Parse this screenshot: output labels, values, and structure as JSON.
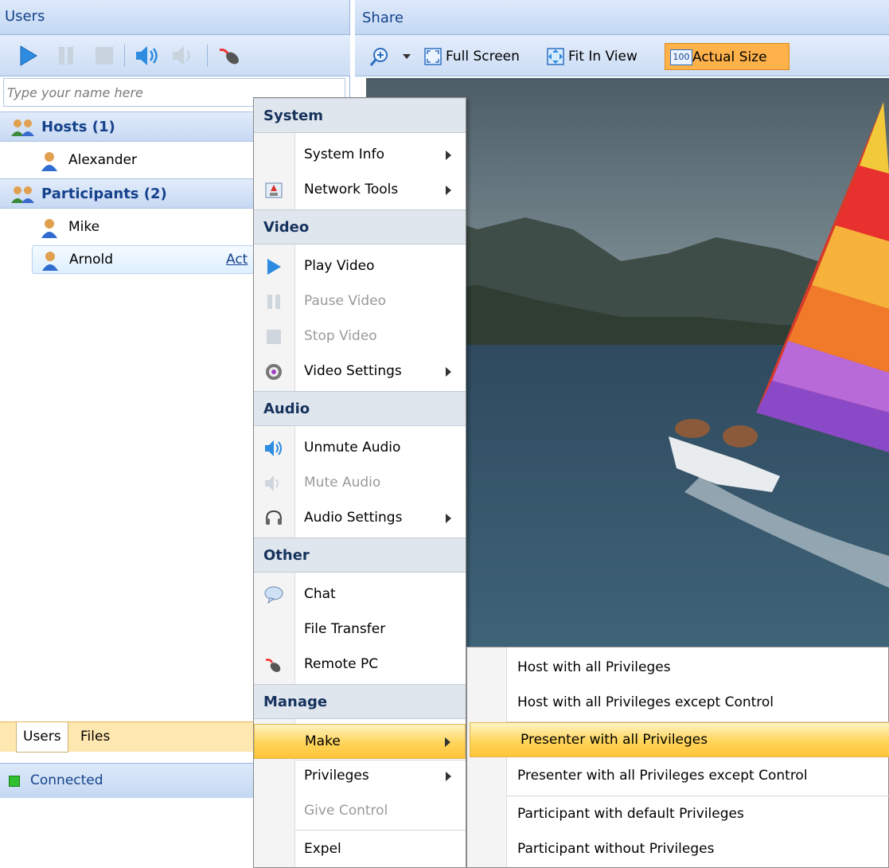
{
  "users_panel": {
    "title": "Users",
    "name_placeholder": "Type your name here",
    "toolbar_icons": [
      "play-icon",
      "pause-icon",
      "stop-icon",
      "speaker-icon",
      "mute-speaker-icon",
      "remote-mouse-icon"
    ],
    "hosts_label": "Hosts (1)",
    "hosts": [
      {
        "name": "Alexander"
      }
    ],
    "participants_label": "Participants (2)",
    "participants": [
      {
        "name": "Mike"
      },
      {
        "name": "Arnold",
        "action": "Act"
      }
    ],
    "tabs": [
      "Users",
      "Files"
    ],
    "status": "Connected"
  },
  "share_panel": {
    "title": "Share",
    "toolbar": {
      "full_screen": "Full Screen",
      "fit_in_view": "Fit In View",
      "actual_size_badge": "100",
      "actual_size": "Actual Size"
    }
  },
  "context_menu": {
    "system_header": "System",
    "system_info": "System Info",
    "network_tools": "Network Tools",
    "video_header": "Video",
    "play_video": "Play Video",
    "pause_video": "Pause Video",
    "stop_video": "Stop Video",
    "video_settings": "Video Settings",
    "audio_header": "Audio",
    "unmute_audio": "Unmute Audio",
    "mute_audio": "Mute Audio",
    "audio_settings": "Audio Settings",
    "other_header": "Other",
    "chat": "Chat",
    "file_transfer": "File Transfer",
    "remote_pc": "Remote PC",
    "manage_header": "Manage",
    "make": "Make",
    "privileges": "Privileges",
    "give_control": "Give Control",
    "expel": "Expel"
  },
  "make_submenu": {
    "host_all": "Host with all Privileges",
    "host_except_control": "Host with all Privileges except Control",
    "presenter_all": "Presenter with all Privileges",
    "presenter_except_control": "Presenter with all Privileges except Control",
    "participant_default": "Participant with default Privileges",
    "participant_none": "Participant without Privileges"
  },
  "colors": {
    "panel_header": "#c3d7f3",
    "header_text": "#15428b",
    "highlight": "#ffd55a",
    "active_toolbar": "#ffb24a"
  }
}
